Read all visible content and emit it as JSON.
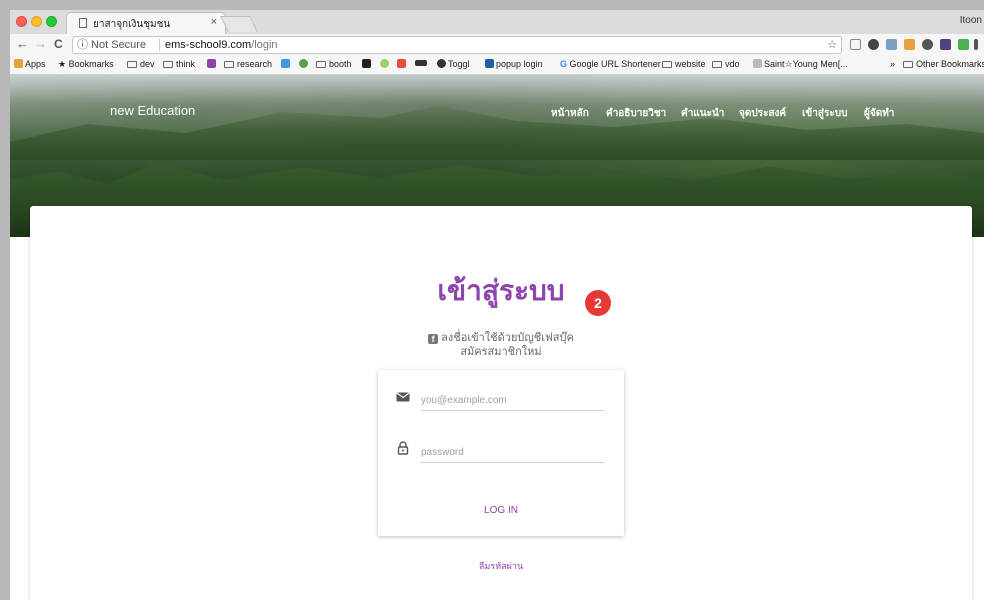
{
  "browser": {
    "tab_title": "ยาสาจุกเงินชุมชน",
    "tab_close": "×",
    "profile": "Itoon",
    "address": {
      "info": "ⓘ Not Secure",
      "host": "ems-school9.com",
      "path": "/login",
      "star": "☆"
    },
    "nav": {
      "back": "←",
      "forward": "→",
      "reload": "C"
    },
    "bookmarks": [
      {
        "label": "Apps"
      },
      {
        "label": "Bookmarks"
      },
      {
        "label": "dev"
      },
      {
        "label": "think"
      },
      {
        "label": "research"
      },
      {
        "label": "booth"
      },
      {
        "label": "Toggl"
      },
      {
        "label": "popup login"
      },
      {
        "label": "Google URL Shortener"
      },
      {
        "label": "website"
      },
      {
        "label": "vdo"
      },
      {
        "label": "Saint☆Young Men[..."
      },
      {
        "label": "»"
      },
      {
        "label": "Other Bookmarks"
      }
    ]
  },
  "site": {
    "brand": "new Education",
    "menu": [
      "หน้าหลัก",
      "คำอธิบายวิชา",
      "คำแนะนำ",
      "จุดประสงค์",
      "เข้าสู่ระบบ",
      "ผู้จัดทำ"
    ]
  },
  "login": {
    "heading": "เข้าสู่ระบบ",
    "badge": "2",
    "facebook_text": "ลงชื่อเข้าใช้ด้วยบัญชีเฟสบุ๊ค",
    "facebook_icon": "f",
    "signup_text": "สมัครสมาชิกใหม่",
    "email_placeholder": "you@example.com",
    "password_placeholder": "password",
    "login_button": "LOG IN",
    "forgot_text": "ลืมรหัสผ่าน"
  },
  "colors": {
    "accent": "#8e44ad",
    "badge": "#e53935"
  }
}
